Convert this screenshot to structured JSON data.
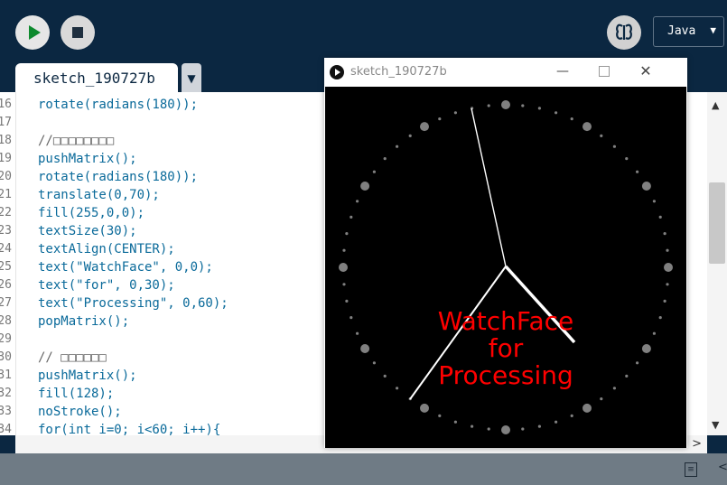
{
  "toolbar": {
    "run_icon": "play-icon",
    "stop_icon": "stop-icon",
    "debug_icon": "butterfly-debug-icon",
    "mode": "Java"
  },
  "tabs": [
    {
      "label": "sketch_190727b"
    }
  ],
  "editor": {
    "line_numbers": [
      "16",
      "17",
      "18",
      "19",
      "20",
      "21",
      "22",
      "23",
      "24",
      "25",
      "26",
      "27",
      "28",
      "29",
      "30",
      "31",
      "32",
      "33",
      "34"
    ],
    "lines": [
      "rotate(radians(180));",
      "",
      "//□□□□□□□□",
      "pushMatrix();",
      "rotate(radians(180));",
      "translate(0,70);",
      "fill(255,0,0);",
      "textSize(30);",
      "textAlign(CENTER);",
      "text(\"WatchFace\", 0,0);",
      "text(\"for\", 0,30);",
      "text(\"Processing\", 0,60);",
      "popMatrix();",
      "",
      "// □□□□□□",
      "pushMatrix();",
      "fill(128);",
      "noStroke();",
      "for(int i=0; i<60; i++){"
    ]
  },
  "sketch_window": {
    "title": "sketch_190727b",
    "minimize": "—",
    "close": "✕",
    "watch_text": [
      "WatchFace",
      "for",
      "Processing"
    ],
    "text_color": "#ff0000",
    "dot_color": "#808080"
  },
  "status_bar": {
    "icon": "console-icon"
  }
}
